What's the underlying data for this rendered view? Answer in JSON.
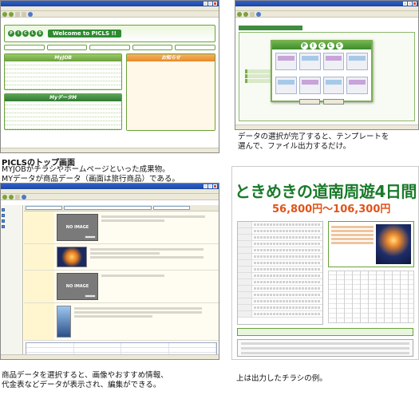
{
  "captions": {
    "top_title": "PICLSのトップ画面",
    "top_line1": "MYJOBがチラシやホームページといった成果物。",
    "top_line2": "MYデータが商品データ（画面は旅行商品）である。",
    "template_line1": "データの選択が完了すると、テンプレートを",
    "template_line2": "選んで、ファイル出力するだけ。",
    "edit_line1": "商品データを選択すると、画像やおすすめ情報、",
    "edit_line2": "代金表などデータが表示され、編集ができる。",
    "flyer_line1": "上は出力したチラシの例。"
  },
  "screen1": {
    "logo_letters": [
      "P",
      "I",
      "C",
      "L",
      "S"
    ],
    "welcome": "Welcome to PICLS !!",
    "myjob_header": "MyJOB",
    "mydata_header": "MyデータM",
    "notice_header": "お知らせ"
  },
  "screen2": {
    "logo_letters": [
      "P",
      "I",
      "C",
      "L",
      "S"
    ]
  },
  "screen3": {
    "no_image_1": "NO IMAGE",
    "no_image_2": "NO IMAGE"
  },
  "flyer": {
    "title": "ときめきの道南周遊4日間",
    "price": "56,800円～106,300円"
  },
  "colors": {
    "picls_green": "#2f8b2f",
    "flyer_title": "#1a7a2a",
    "flyer_price": "#e0541a",
    "titlebar_blue": "#2f63c9"
  }
}
